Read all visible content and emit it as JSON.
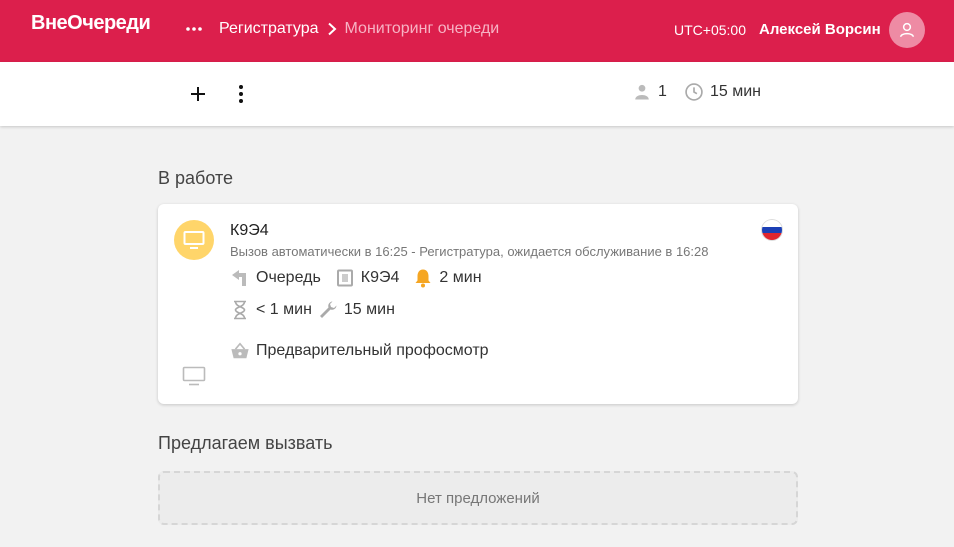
{
  "header": {
    "logo": "ВнеОчереди",
    "breadcrumb": {
      "parent": "Регистратура",
      "current": "Мониторинг очереди"
    },
    "timezone": "UTC+05:00",
    "user_name": "Алексей Ворсин"
  },
  "toolbar": {
    "people_count": "1",
    "wait_time": "15 мин"
  },
  "in_work": {
    "title": "В работе",
    "ticket": {
      "code": "К9Э4",
      "status": "Вызов автоматически в 16:25 - Регистратура, ожидается обслуживание в 16:28",
      "queue": "Очередь",
      "ticket_number": "К9Э4",
      "alert_time": "2 мин",
      "wait_time": "< 1 мин",
      "service_time": "15 мин",
      "service": "Предварительный профосмотр"
    }
  },
  "suggest": {
    "title": "Предлагаем вызвать",
    "empty": "Нет предложений"
  },
  "colors": {
    "brand": "#dc1f4c",
    "accent_yellow": "#ffd56a",
    "bell": "#f5a623"
  },
  "icons": [
    "more-horizontal-icon",
    "chevron-right-icon",
    "user-avatar-icon",
    "plus-icon",
    "more-vertical-icon",
    "person-icon",
    "clock-icon",
    "monitor-icon",
    "russia-flag-icon",
    "queue-arrow-icon",
    "ticket-icon",
    "bell-icon",
    "hourglass-icon",
    "wrench-icon",
    "basket-icon"
  ]
}
